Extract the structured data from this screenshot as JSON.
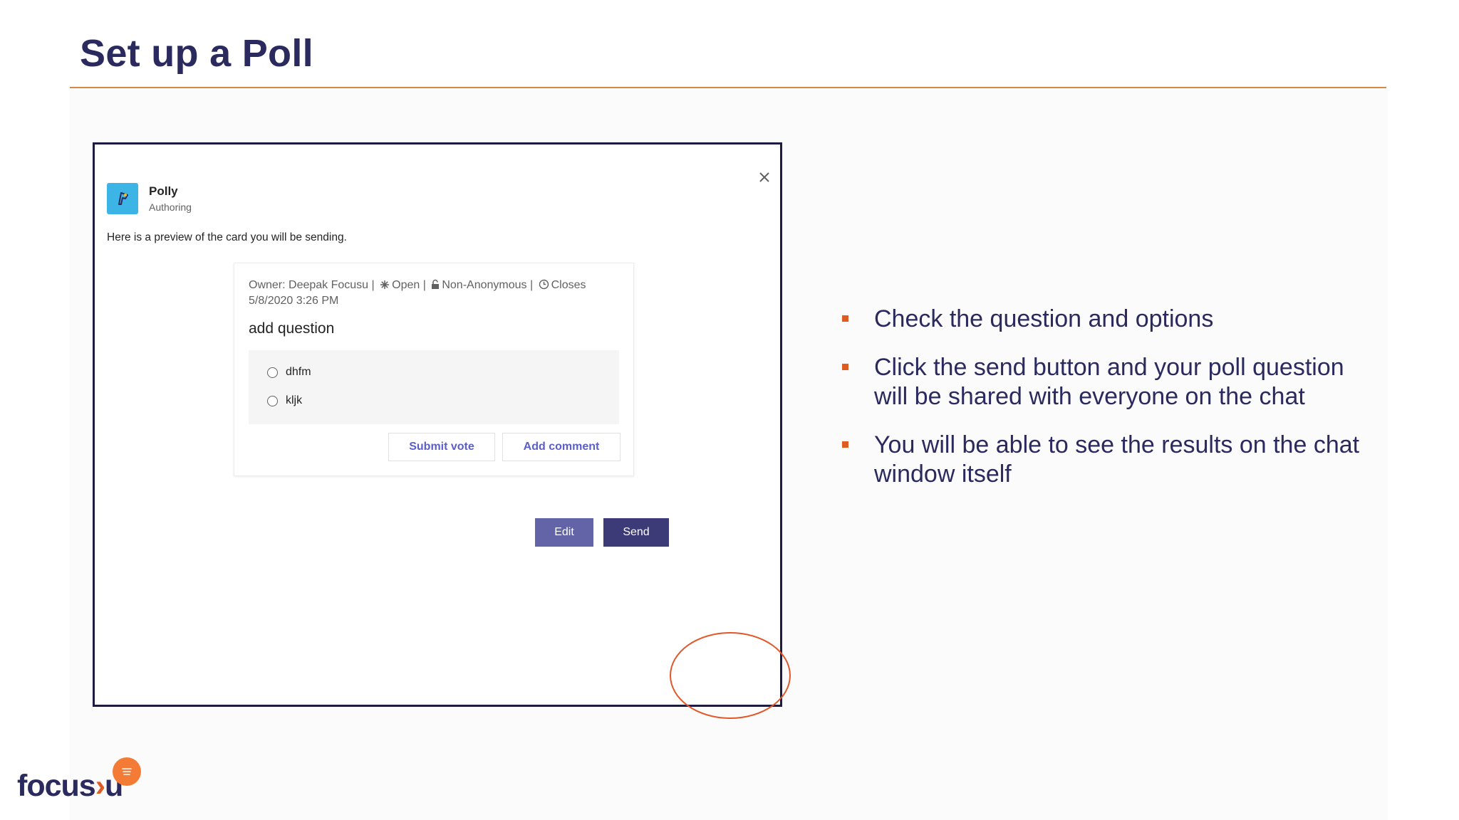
{
  "slide": {
    "title": "Set up a Poll",
    "colors": {
      "title": "#2b2a5f",
      "rule": "#d6893f",
      "bullet": "#e05b1f",
      "highlight": "#e2572a"
    }
  },
  "dialog": {
    "app_name": "Polly",
    "app_subtitle": "Authoring",
    "preview_text": "Here is a preview of the card you will be sending.",
    "close_icon": "close-icon",
    "card": {
      "meta": {
        "owner": "Owner: Deepak Focusu |",
        "status": "Open |",
        "visibility": "Non-Anonymous |",
        "closes": "Closes",
        "close_date": "5/8/2020 3:26 PM"
      },
      "question": "add question",
      "options": [
        "dhfm",
        "kljk"
      ],
      "submit_vote_label": "Submit vote",
      "add_comment_label": "Add comment"
    },
    "edit_label": "Edit",
    "send_label": "Send"
  },
  "bullets": [
    "Check the question and options",
    "Click the send button and your poll question will be shared with everyone on the chat",
    "You will be able to see the results on the chat window itself"
  ],
  "logo": {
    "text_left": "focus",
    "text_right": "u"
  }
}
